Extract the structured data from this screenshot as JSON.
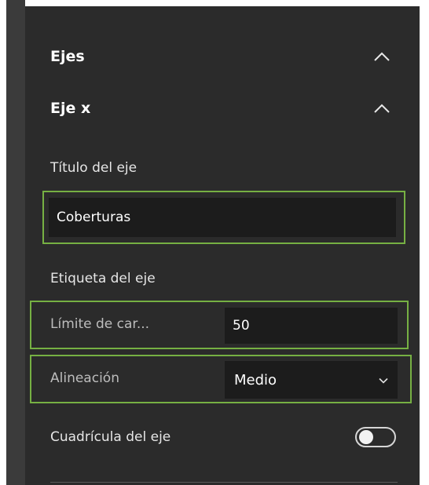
{
  "colors": {
    "panel_bg": "#2b2b2b",
    "input_bg": "#1c1c1c",
    "highlight": "#76b043",
    "text": "#ffffff"
  },
  "panel": {
    "axes_title": "Ejes",
    "x_axis_title": "Eje x",
    "axis_title_label": "Título del eje",
    "axis_title_value": "Coberturas",
    "axis_label_heading": "Etiqueta del eje",
    "char_limit_label": "Límite de car...",
    "char_limit_value": "50",
    "alignment_label": "Alineación",
    "alignment_value": "Medio",
    "grid_label": "Cuadrícula del eje",
    "grid_enabled": false
  },
  "icons": {
    "axes_collapse": "chevron-up-icon",
    "x_axis_collapse": "chevron-up-icon",
    "alignment_dropdown": "chevron-down-icon"
  }
}
